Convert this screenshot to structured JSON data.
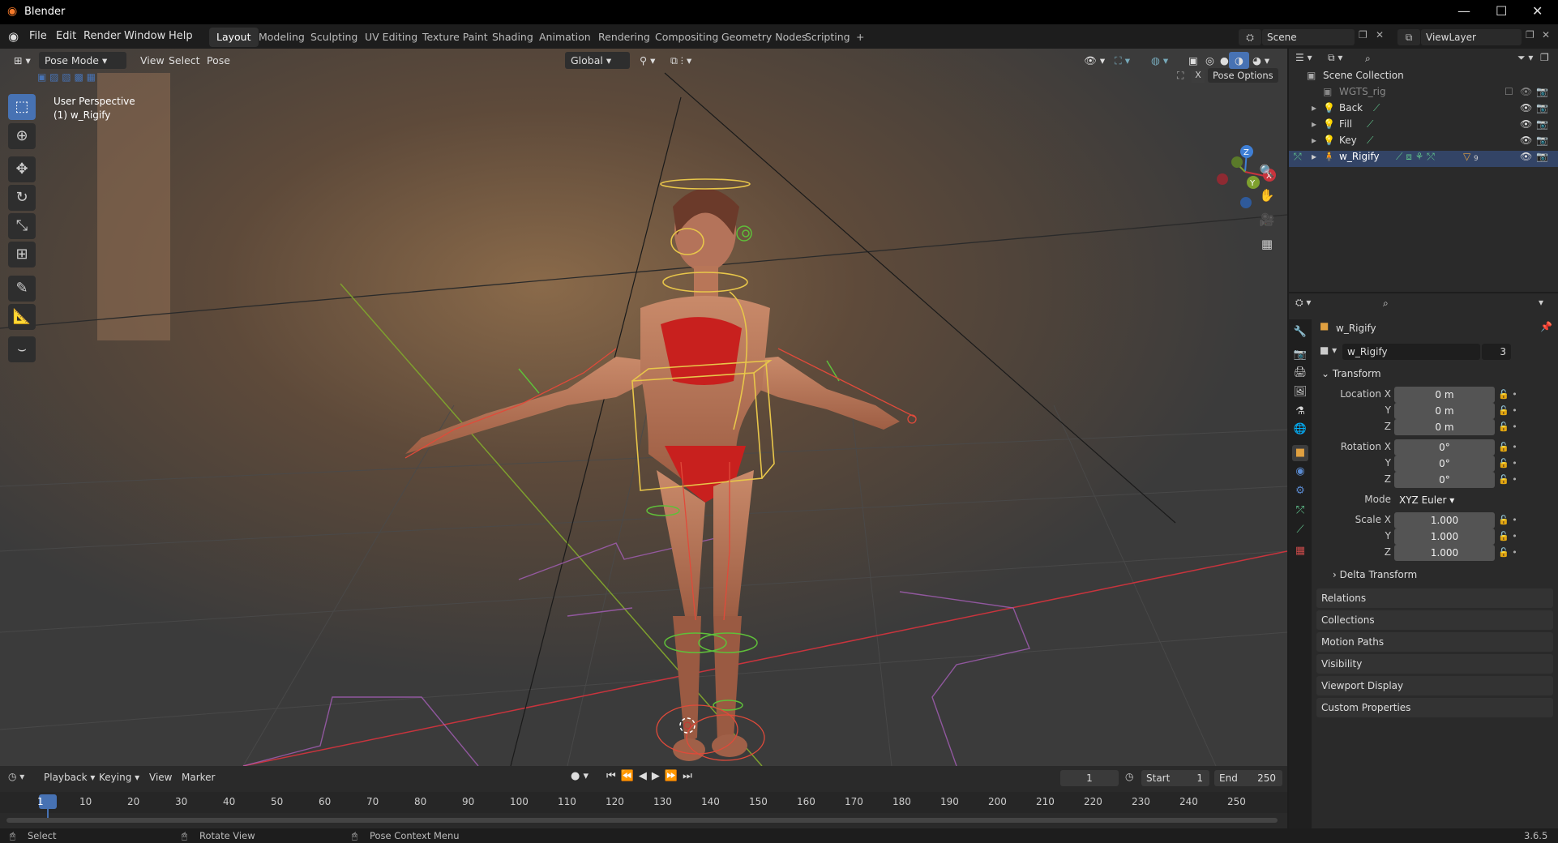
{
  "title_bar": {
    "app_title": "Blender",
    "minimize": "—",
    "maximize": "☐",
    "close": "✕"
  },
  "menu": {
    "file": "File",
    "edit": "Edit",
    "render": "Render",
    "window": "Window",
    "help": "Help"
  },
  "workspaces": [
    "Layout",
    "Modeling",
    "Sculpting",
    "UV Editing",
    "Texture Paint",
    "Shading",
    "Animation",
    "Rendering",
    "Compositing",
    "Geometry Nodes",
    "Scripting"
  ],
  "workspace_add": "+",
  "scene": {
    "name": "Scene",
    "view_layer": "ViewLayer"
  },
  "viewport_header": {
    "mode": "Pose Mode",
    "view": "View",
    "select": "Select",
    "pose": "Pose",
    "transform_orientation": "Global",
    "pose_options": "Pose Options",
    "x_axis": "X",
    "y_axis": "Y",
    "z_axis": "Z"
  },
  "viewport_overlay": {
    "perspective": "User Perspective",
    "object": "(1) w_Rigify"
  },
  "outliner": {
    "root": "Scene Collection",
    "items": [
      {
        "name": "WGTS_rig"
      },
      {
        "name": "Back"
      },
      {
        "name": "Fill"
      },
      {
        "name": "Key"
      },
      {
        "name": "w_Rigify",
        "badge": "9"
      }
    ]
  },
  "properties": {
    "object_name": "w_Rigify",
    "datablock_name": "w_Rigify",
    "user_count": "3",
    "transform_header": "Transform",
    "location": {
      "label": "Location X",
      "x": "0 m",
      "y": "0 m",
      "z": "0 m"
    },
    "rotation": {
      "label": "Rotation X",
      "x": "0°",
      "y": "0°",
      "z": "0°"
    },
    "mode": {
      "label": "Mode",
      "value": "XYZ Euler"
    },
    "scale": {
      "label": "Scale X",
      "x": "1.000",
      "y": "1.000",
      "z": "1.000"
    },
    "axis_y": "Y",
    "axis_z": "Z",
    "delta_transform": "Delta Transform",
    "sections": [
      "Relations",
      "Collections",
      "Motion Paths",
      "Visibility",
      "Viewport Display",
      "Custom Properties"
    ]
  },
  "timeline": {
    "playback": "Playback",
    "keying": "Keying",
    "view": "View",
    "marker": "Marker",
    "current_frame": "1",
    "start_label": "Start",
    "start": "1",
    "end_label": "End",
    "end": "250",
    "ticks": [
      "1",
      "10",
      "20",
      "30",
      "40",
      "50",
      "60",
      "70",
      "80",
      "90",
      "100",
      "110",
      "120",
      "130",
      "140",
      "150",
      "160",
      "170",
      "180",
      "190",
      "200",
      "210",
      "220",
      "230",
      "240",
      "250"
    ]
  },
  "status_bar": {
    "select": "Select",
    "rotate_view": "Rotate View",
    "context_menu": "Pose Context Menu",
    "version": "3.6.5"
  },
  "colors": {
    "accent": "#4772b3",
    "bone_yellow": "#e8c64a",
    "bone_green": "#5fbf3a",
    "bone_red": "#e04a3a",
    "x_axis": "#c8343d",
    "y_axis": "#7ea02e",
    "z_axis": "#3f7fd5"
  }
}
